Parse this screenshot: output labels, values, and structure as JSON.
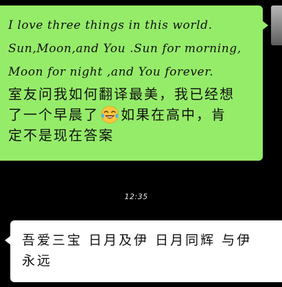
{
  "messages": {
    "sent": {
      "lines": [
        "I love three things in this world.",
        "Sun,Moon,and You .Sun for morning,",
        "Moon for night ,and You forever.",
        "室友问我如何翻译最美，我已经想",
        "了一个早晨了",
        "如果在高中，肯",
        "定不是现在答案"
      ],
      "emoji": "face-with-tears-of-joy"
    },
    "timestamp": "12:35",
    "received": {
      "lines": [
        "吾爱三宝 日月及伊 日月同辉 与伊",
        "永远"
      ]
    }
  },
  "colors": {
    "background": "#000000",
    "sent_bubble": "#95EC69",
    "received_bubble": "#FFFFFF"
  }
}
